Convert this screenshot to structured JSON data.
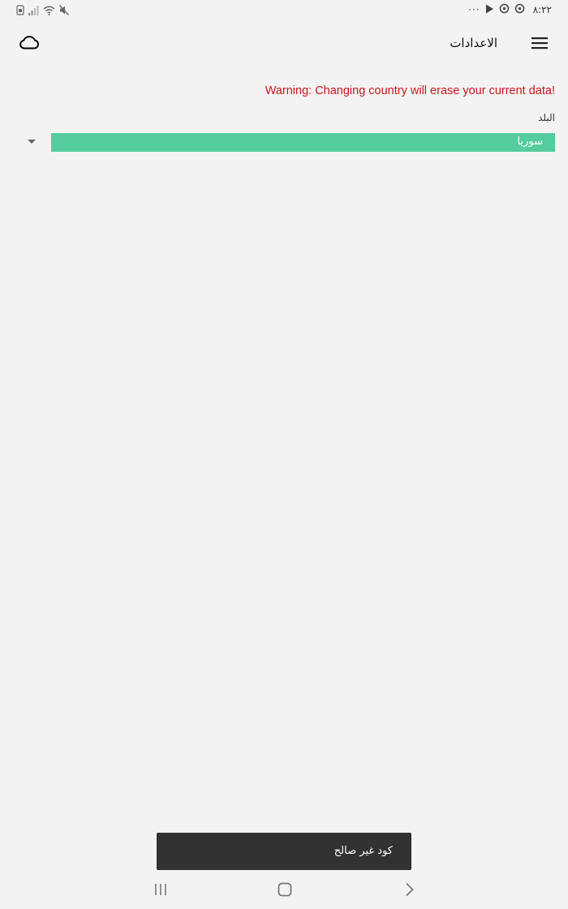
{
  "status_bar": {
    "time": "٨:٢٢",
    "dots": "···"
  },
  "header": {
    "title": "الاعدادات"
  },
  "settings": {
    "warning": "Warning: Changing country will erase your current data!",
    "country_label": "البلد",
    "country_value": "سوريا"
  },
  "snackbar": {
    "message": "كود غير صالح"
  },
  "colors": {
    "background": "#f3f3f3",
    "select_fill": "#55cc9d",
    "warning_text": "#c8151b",
    "snackbar_bg": "#323232"
  },
  "icons": {
    "cloud": "cloud-icon",
    "menu": "menu-icon",
    "dropdown": "dropdown-arrow-icon",
    "recents": "recents-icon",
    "home": "home-icon",
    "back": "back-icon"
  }
}
